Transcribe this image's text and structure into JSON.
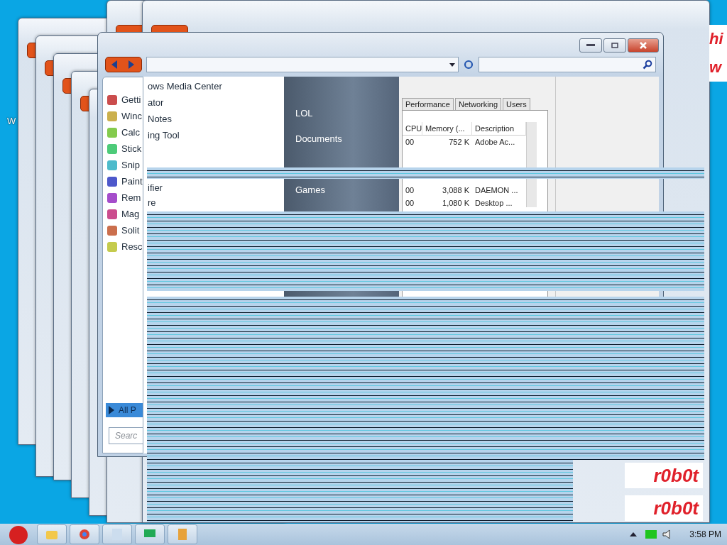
{
  "desktop": {
    "icon_label": "W",
    "banner_texts": [
      "hi",
      "w",
      "r0b0t",
      "r0b0t"
    ]
  },
  "window": {
    "start_list": [
      "Getti",
      "Winc",
      "Calc",
      "Stick",
      "Snip",
      "Paint",
      "Rem",
      "Mag",
      "Solit",
      "Resc"
    ],
    "all_programs": {
      "label": "All P",
      "selected": true
    },
    "search": {
      "placeholder": "Searc"
    },
    "program_list": [
      "ows Media Center",
      "ator",
      "Notes",
      "ing Tool"
    ],
    "program_list_lower": [
      "ifier",
      "re"
    ],
    "places": [
      "LOL",
      "Documents"
    ],
    "places_lower": [
      "Games"
    ],
    "task_manager": {
      "tabs": [
        {
          "label": "Performance",
          "selected": false
        },
        {
          "label": "Networking",
          "selected": false
        },
        {
          "label": "Users",
          "selected": false
        }
      ],
      "columns": [
        "CPU",
        "Memory (...",
        "Description"
      ],
      "rows": [
        [
          "00",
          "752 K",
          "Adobe Ac..."
        ]
      ],
      "rows_lower": [
        [
          "00",
          "3,088 K",
          "DAEMON ..."
        ],
        [
          "00",
          "1,080 K",
          "Desktop ..."
        ]
      ]
    }
  },
  "taskbar": {
    "clock": "3:58 PM"
  }
}
